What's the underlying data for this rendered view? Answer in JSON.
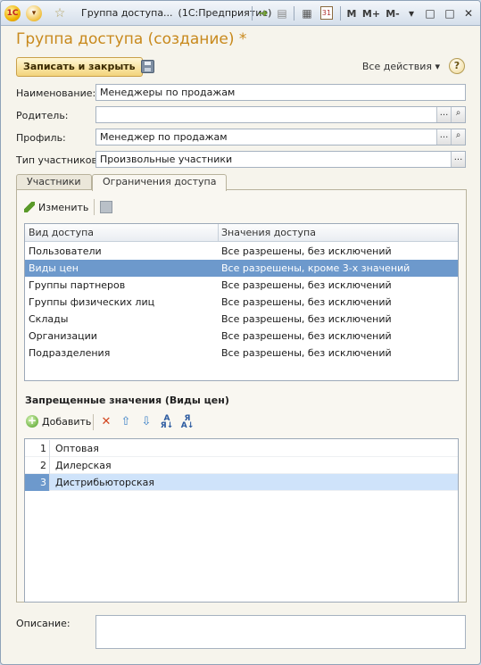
{
  "titlebar": {
    "title": "Группа доступа...",
    "app": "(1С:Предприятие)",
    "logo": "1С",
    "mem_buttons": [
      "M",
      "M+",
      "M-"
    ],
    "minimize_glyph": "▾",
    "restore_glyph": "□",
    "close_glyph": "✕"
  },
  "form": {
    "title": "Группа доступа (создание) *",
    "save_close_label": "Записать и закрыть",
    "all_actions_label": "Все действия ▾",
    "help_glyph": "?"
  },
  "fields": {
    "name_label": "Наименование:",
    "name_value": "Менеджеры по продажам",
    "parent_label": "Родитель:",
    "parent_value": "",
    "profile_label": "Профиль:",
    "profile_value": "Менеджер по продажам",
    "member_type_label": "Тип участников:",
    "member_type_value": "Произвольные участники",
    "select_glyph": "...",
    "open_glyph": "🔍"
  },
  "tabs": [
    {
      "label": "Участники",
      "active": false
    },
    {
      "label": "Ограничения доступа",
      "active": true
    }
  ],
  "access_toolbar": {
    "edit_label": "Изменить"
  },
  "access_table": {
    "columns": [
      "Вид доступа",
      "Значения доступа"
    ],
    "rows": [
      {
        "kind": "Пользователи",
        "value": "Все разрешены, без исключений",
        "selected": false
      },
      {
        "kind": "Виды цен",
        "value": "Все разрешены, кроме 3-х значений",
        "selected": true
      },
      {
        "kind": "Группы партнеров",
        "value": "Все разрешены, без исключений",
        "selected": false
      },
      {
        "kind": "Группы физических лиц",
        "value": "Все разрешены, без исключений",
        "selected": false
      },
      {
        "kind": "Склады",
        "value": "Все разрешены, без исключений",
        "selected": false
      },
      {
        "kind": "Организации",
        "value": "Все разрешены, без исключений",
        "selected": false
      },
      {
        "kind": "Подразделения",
        "value": "Все разрешены, без исключений",
        "selected": false
      }
    ]
  },
  "forbidden": {
    "title": "Запрещенные значения (Виды цен)",
    "add_label": "Добавить",
    "rows": [
      {
        "num": "1",
        "value": "Оптовая",
        "selected": false
      },
      {
        "num": "2",
        "value": "Дилерская",
        "selected": false
      },
      {
        "num": "3",
        "value": "Дистрибьюторская",
        "selected": true
      }
    ]
  },
  "description": {
    "label": "Описание:",
    "value": ""
  },
  "colors": {
    "accent_title": "#c8891c",
    "selection": "#6d99cc",
    "selection_light": "#cfe3fa",
    "primary_button": "#f3d47c"
  }
}
